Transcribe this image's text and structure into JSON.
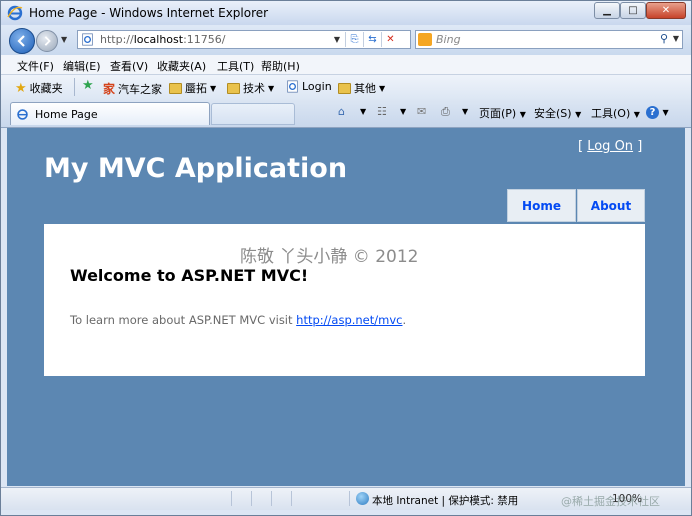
{
  "window": {
    "title": "Home Page - Windows Internet Explorer",
    "minimize_label": "▁",
    "maximize_label": "□",
    "close_label": "✕"
  },
  "address_bar": {
    "url_prefix": "http://",
    "url_host": "localhost",
    "url_rest": ":11756/",
    "search_placeholder": "Bing"
  },
  "menu": [
    "文件(F)",
    "编辑(E)",
    "查看(V)",
    "收藏夹(A)",
    "工具(T)",
    "帮助(H)"
  ],
  "favorites": {
    "main_label": "收藏夹",
    "items": [
      "汽车之家",
      "蜃拓",
      "技术",
      "Login",
      "其他"
    ]
  },
  "tab": {
    "label": "Home Page"
  },
  "command_bar": {
    "page_label": "页面(P)",
    "safety_label": "安全(S)",
    "tools_label": "工具(O)"
  },
  "site": {
    "title": "My MVC Application",
    "login_open": "[",
    "login_link": "Log On",
    "login_close": "]",
    "nav": [
      "Home",
      "About"
    ],
    "heading": "Welcome to ASP.NET MVC!",
    "intro_text": "To learn more about ASP.NET MVC visit",
    "intro_link": "http://asp.net/mvc",
    "intro_end": ".",
    "watermark": "陈敬  丫头小静  © 2012"
  },
  "status": {
    "zone": "本地 Intranet | 保护模式: 禁用",
    "zoom": "100%",
    "corner_watermark": "@稀土掘金技术社区"
  },
  "colors": {
    "site_background": "#5c87b2",
    "link_blue": "#034af3",
    "content_bg": "#ffffff"
  }
}
